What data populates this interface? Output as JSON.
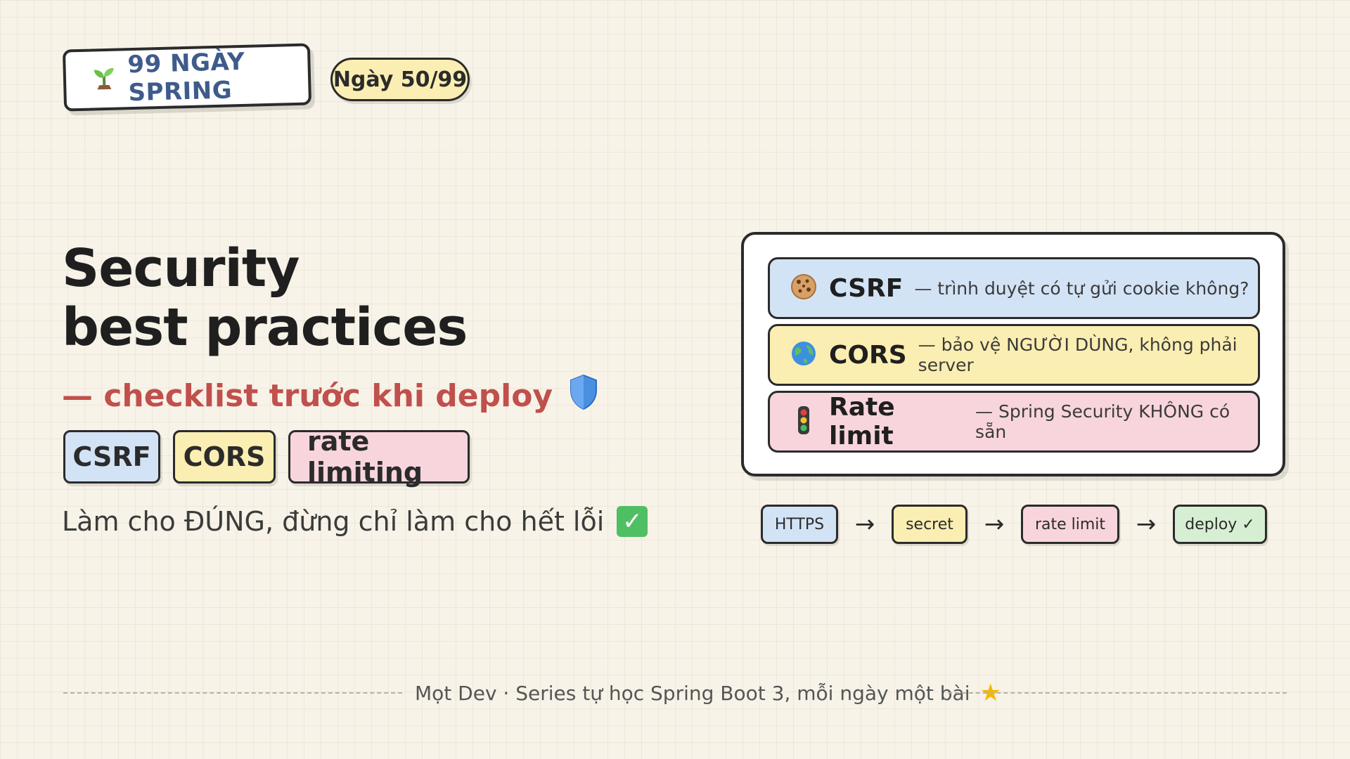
{
  "header": {
    "brand_icon": "seedling-icon",
    "brand": "99 NGÀY SPRING",
    "day": "Ngày 50/99"
  },
  "hero": {
    "title_line1": "Security",
    "title_line2": "best practices",
    "subtitle": "— checklist trước khi deploy",
    "subtitle_icon": "shield-icon",
    "chips": [
      "CSRF",
      "CORS",
      "rate limiting"
    ],
    "tagline": "Làm cho ĐÚNG, đừng chỉ làm cho hết lỗi",
    "tagline_icon": "check-mark-icon"
  },
  "panel": {
    "rows": [
      {
        "icon": "cookie-icon",
        "title": "CSRF",
        "desc": "— trình duyệt có tự gửi cookie không?"
      },
      {
        "icon": "globe-icon",
        "title": "CORS",
        "desc": "— bảo vệ NGƯỜI DÙNG, không phải server"
      },
      {
        "icon": "traffic-light-icon",
        "title": "Rate limit",
        "desc": "— Spring Security KHÔNG có sẵn"
      }
    ]
  },
  "flow": {
    "steps": [
      "HTTPS",
      "secret",
      "rate limit",
      "deploy ✓"
    ],
    "arrow": "→"
  },
  "footer": {
    "text": "Mọt Dev · Series tự học Spring Boot 3, mỗi ngày một bài",
    "icon": "star-icon"
  },
  "colors": {
    "background": "#f8f3e8",
    "blue": "#d3e3f6",
    "yellow": "#fbeeb2",
    "pink": "#f8d5dc",
    "green": "#d6efd2",
    "accent_red": "#c0504d",
    "brand_blue": "#3e5b8a"
  }
}
